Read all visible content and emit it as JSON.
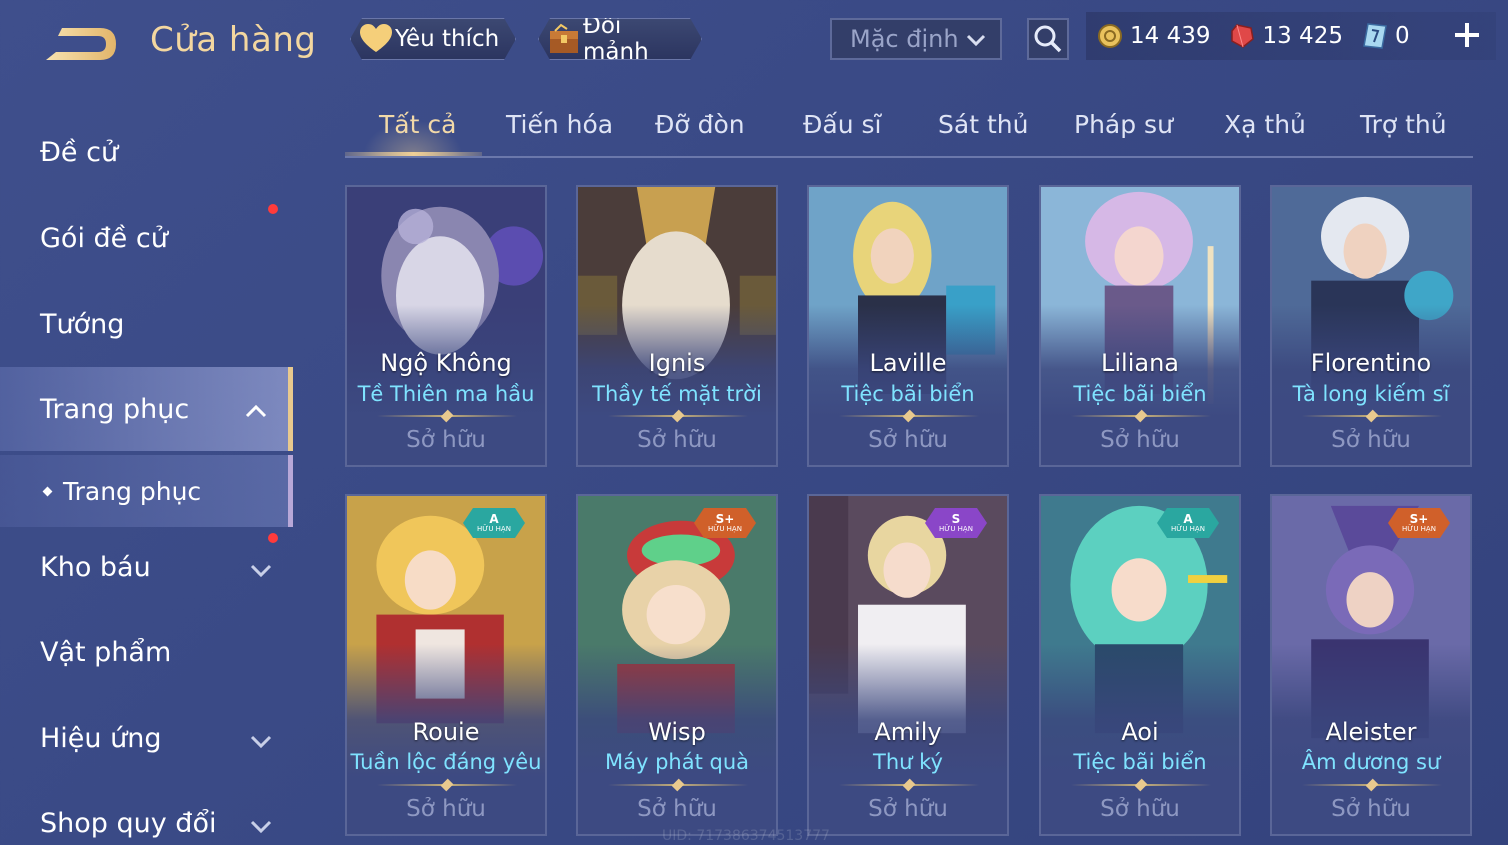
{
  "header": {
    "title": "Cửa hàng",
    "favorites_label": "Yêu thích",
    "exchange_label": "Đổi mảnh",
    "sort_value": "Mặc định"
  },
  "currency": {
    "gold": "14 439",
    "ruby": "13 425",
    "voucher": "0"
  },
  "sidebar": {
    "items": [
      {
        "label": "Đề cử"
      },
      {
        "label": "Gói đề cử"
      },
      {
        "label": "Tướng"
      },
      {
        "label": "Trang phục"
      },
      {
        "label": "Trang phục"
      },
      {
        "label": "Kho báu"
      },
      {
        "label": "Vật phẩm"
      },
      {
        "label": "Hiệu ứng"
      },
      {
        "label": "Shop quy đổi"
      }
    ]
  },
  "tabs": [
    "Tất cả",
    "Tiến hóa",
    "Đỡ đòn",
    "Đấu sĩ",
    "Sát thủ",
    "Pháp sư",
    "Xạ thủ",
    "Trợ thủ"
  ],
  "owned_label": "Sở hữu",
  "limited_label": "HỮU HẠN",
  "cards": [
    {
      "hero": "Ngộ Không",
      "skin": "Tề Thiên ma hầu",
      "grade": ""
    },
    {
      "hero": "Ignis",
      "skin": "Thầy tế mặt trời",
      "grade": ""
    },
    {
      "hero": "Laville",
      "skin": "Tiệc bãi biển",
      "grade": ""
    },
    {
      "hero": "Liliana",
      "skin": "Tiệc bãi biển",
      "grade": ""
    },
    {
      "hero": "Florentino",
      "skin": "Tà long kiếm sĩ",
      "grade": ""
    },
    {
      "hero": "Rouie",
      "skin": "Tuần lộc đáng yêu",
      "grade": "A"
    },
    {
      "hero": "Wisp",
      "skin": "Máy phát quà",
      "grade": "S+"
    },
    {
      "hero": "Amily",
      "skin": "Thư ký",
      "grade": "S"
    },
    {
      "hero": "Aoi",
      "skin": "Tiệc bãi biển",
      "grade": "A"
    },
    {
      "hero": "Aleister",
      "skin": "Âm dương sư",
      "grade": "S+"
    }
  ],
  "uid_text": "UID: 717386374513777",
  "colors": {
    "background": "#3b4a86",
    "title_gold": "#f3d7a0",
    "skin_name_cyan": "#7fe3ff",
    "owned_grey": "#8e98c2",
    "notification_red": "#ff3b3b",
    "badge_A": "#2aa7a0",
    "badge_S": "#8a46c8",
    "badge_Splus": "#d0602a"
  },
  "icons": {
    "back": "back-arrow-icon",
    "favorites": "heart-icon",
    "exchange": "chest-icon",
    "sort": "chevron-down-icon",
    "search": "search-icon",
    "gold": "gold-coin-icon",
    "ruby": "ruby-gem-icon",
    "voucher": "voucher-icon",
    "add": "plus-icon"
  }
}
